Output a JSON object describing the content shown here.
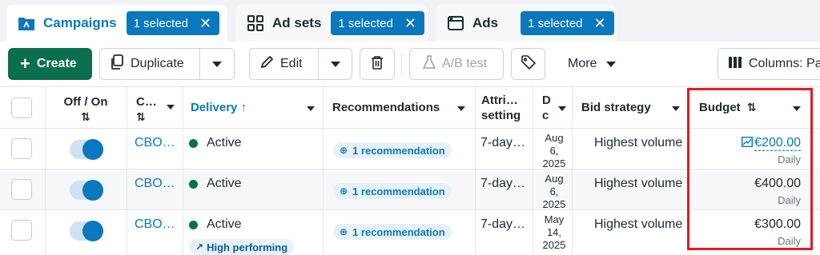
{
  "tabs": [
    {
      "label": "Campaigns",
      "badge": "1 selected",
      "icon": "folder-icon"
    },
    {
      "label": "Ad sets",
      "badge": "1 selected",
      "icon": "grid-icon"
    },
    {
      "label": "Ads",
      "badge": "1 selected",
      "icon": "ad-window-icon"
    }
  ],
  "toolbar": {
    "create": "Create",
    "duplicate": "Duplicate",
    "edit": "Edit",
    "ab_test": "A/B test",
    "more": "More",
    "columns": "Columns: Pa"
  },
  "headers": {
    "off_on": "Off / On",
    "campaign": "C…",
    "delivery": "Delivery ↑",
    "recommendations": "Recommendations",
    "attribution_line1": "Attri…",
    "attribution_line2": "setting",
    "date_line1": "D",
    "date_line2": "c",
    "bid_strategy": "Bid strategy",
    "budget": "Budget"
  },
  "rows": [
    {
      "campaign": "CBO…",
      "delivery": "Active",
      "recommendation": "1 recommendation",
      "attribution": "7-day…",
      "date_parts": [
        "Aug",
        "6,",
        "2025"
      ],
      "bid": "Highest volume",
      "budget": "€200.00",
      "budget_type": "Daily",
      "budget_linked": true
    },
    {
      "campaign": "CBO…",
      "delivery": "Active",
      "recommendation": "1 recommendation",
      "attribution": "7-day…",
      "date_parts": [
        "Aug",
        "6,",
        "2025"
      ],
      "bid": "Highest volume",
      "budget": "€400.00",
      "budget_type": "Daily",
      "budget_linked": false
    },
    {
      "campaign": "CBO…",
      "delivery": "Active",
      "delivery_tag": "High performing",
      "recommendation": "1 recommendation",
      "attribution": "7-day…",
      "date_parts": [
        "May",
        "14,",
        "2025"
      ],
      "bid": "Highest volume",
      "budget": "€300.00",
      "budget_type": "Daily",
      "budget_linked": false
    }
  ],
  "colors": {
    "accent": "#0a78be",
    "create_green": "#0b6e4f",
    "highlight": "#e31b23"
  }
}
